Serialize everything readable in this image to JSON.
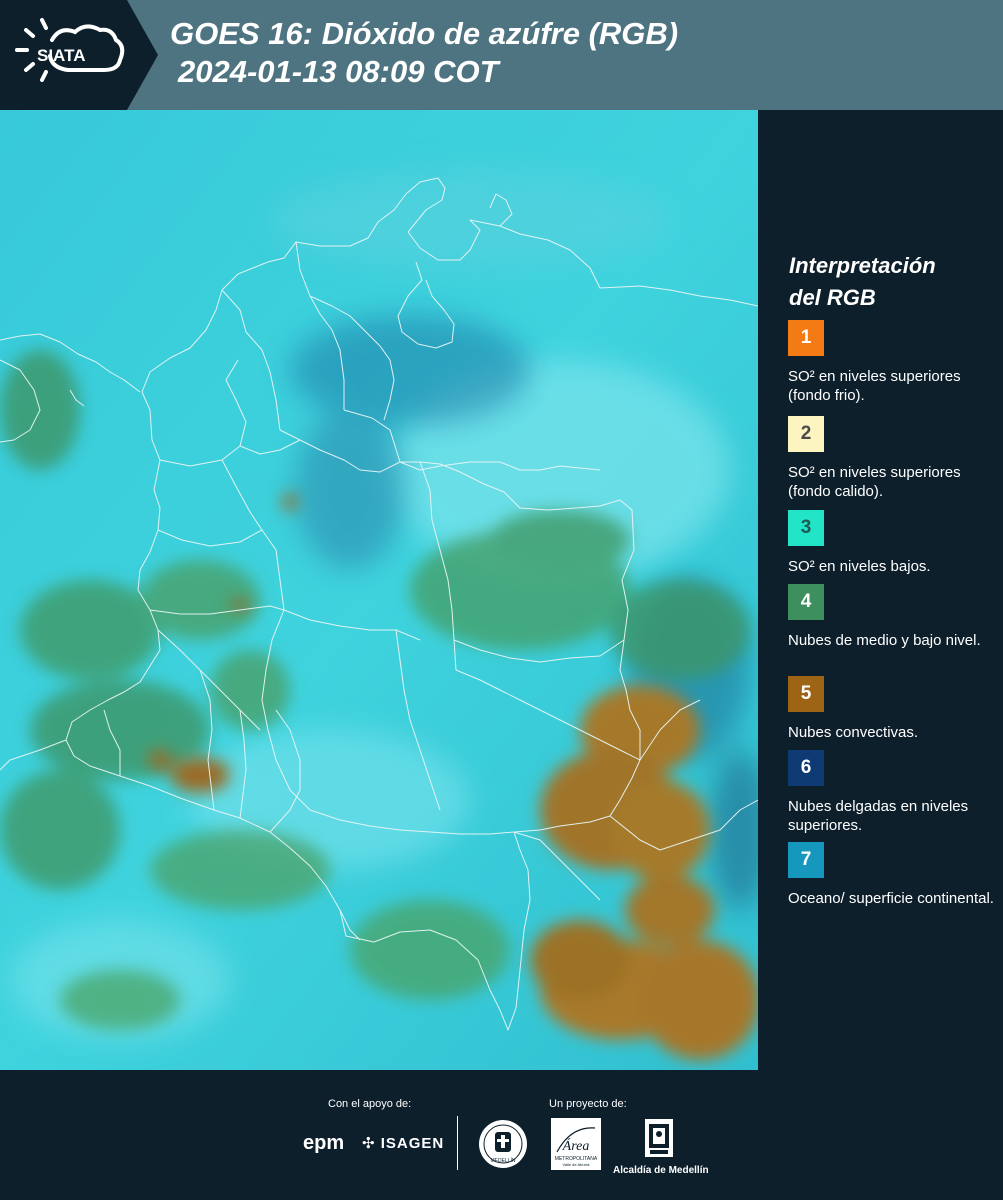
{
  "header": {
    "logo_text": "SIATA",
    "title_line1": "GOES 16: Dióxido de azúfre (RGB)",
    "title_line2": "2024-01-13 08:09 COT"
  },
  "legend": {
    "title_line1": "Interpretación",
    "title_line2": "del RGB",
    "items": [
      {
        "number": "1",
        "text": "SO² en niveles superiores (fondo frio).",
        "color": "#f47b14",
        "number_color": "#ffffff"
      },
      {
        "number": "2",
        "text": "SO² en niveles superiores (fondo calido).",
        "color": "#fdf5c0",
        "number_color": "#4a4a4a"
      },
      {
        "number": "3",
        "text": "SO² en niveles bajos.",
        "color": "#22e5c8",
        "number_color": "#1f5a55"
      },
      {
        "number": "4",
        "text": "Nubes de medio y bajo nivel.",
        "color": "#3d8f5e",
        "number_color": "#ffffff"
      },
      {
        "number": "5",
        "text": "Nubes convectivas.",
        "color": "#9c6414",
        "number_color": "#ffffff"
      },
      {
        "number": "6",
        "text": "Nubes delgadas en niveles superiores.",
        "color": "#0d3a72",
        "number_color": "#ffffff"
      },
      {
        "number": "7",
        "text": "Oceano/ superficie continental.",
        "color": "#1697bd",
        "number_color": "#ffffff"
      }
    ]
  },
  "footer": {
    "support_label": "Con el apoyo de:",
    "project_label": "Un proyecto de:",
    "epm_logo": "epm",
    "isagen_logo": "ISAGEN",
    "alcaldia_logo": "Alcaldía de Medellín",
    "area_logo": "Área",
    "area_subtitle": "METROPOLITANA",
    "area_subtitle2": "Valle de Aburrá",
    "seal_text": "MEDELLÍN"
  }
}
